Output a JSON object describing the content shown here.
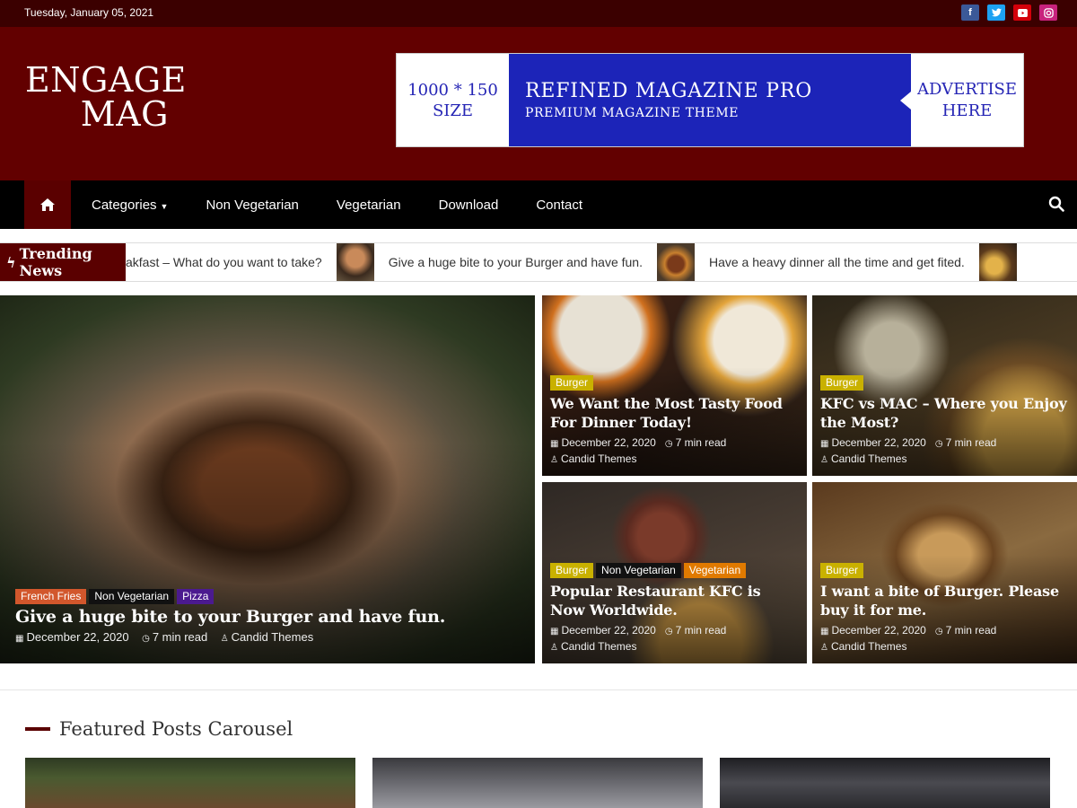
{
  "topbar": {
    "date": "Tuesday, January 05, 2021",
    "social": [
      {
        "icon": "facebook-icon",
        "glyph": "f",
        "color": "#3b5998"
      },
      {
        "icon": "twitter-icon",
        "glyph": "t",
        "color": "#1da1f2"
      },
      {
        "icon": "youtube-icon",
        "glyph": "▶",
        "color": "#d4000a"
      },
      {
        "icon": "instagram-icon",
        "glyph": "◎",
        "color": "#c8227d"
      }
    ]
  },
  "header": {
    "logo_line1": "ENGAGE",
    "logo_line2": "MAG",
    "ad": {
      "left_line1": "1000 * 150",
      "left_line2": "SIZE",
      "title": "REFINED MAGAZINE PRO",
      "subtitle": "PREMIUM MAGAZINE THEME",
      "right_line1": "ADVERTISE",
      "right_line2": "HERE"
    }
  },
  "nav": {
    "items": [
      "Categories",
      "Non Vegetarian",
      "Vegetarian",
      "Download",
      "Contact"
    ]
  },
  "trending": {
    "label": "Trending News",
    "items": [
      "akfast – What do you want to take?",
      "Give a huge bite to your Burger and have fun.",
      "Have a heavy dinner all the time and get fited."
    ]
  },
  "featured": {
    "main": {
      "tags": [
        "French Fries",
        "Non Vegetarian",
        "Pizza"
      ],
      "title": "Give a huge bite to your Burger and have fun.",
      "date": "December 22, 2020",
      "read": "7 min read",
      "author": "Candid Themes"
    },
    "side": [
      {
        "tags": [
          "Burger"
        ],
        "title": "We Want the Most Tasty Food For Dinner Today!",
        "date": "December 22, 2020",
        "read": "7 min read",
        "author": "Candid Themes"
      },
      {
        "tags": [
          "Burger"
        ],
        "title": "KFC vs MAC – Where you Enjoy the Most?",
        "date": "December 22, 2020",
        "read": "7 min read",
        "author": "Candid Themes"
      },
      {
        "tags": [
          "Burger",
          "Non Vegetarian",
          "Vegetarian"
        ],
        "title": "Popular Restaurant KFC is Now Worldwide.",
        "date": "December 22, 2020",
        "read": "7 min read",
        "author": "Candid Themes"
      },
      {
        "tags": [
          "Burger"
        ],
        "title": "I want a bite of Burger. Please buy it for me.",
        "date": "December 22, 2020",
        "read": "7 min read",
        "author": "Candid Themes"
      }
    ]
  },
  "section": {
    "title": "Featured Posts Carousel"
  }
}
